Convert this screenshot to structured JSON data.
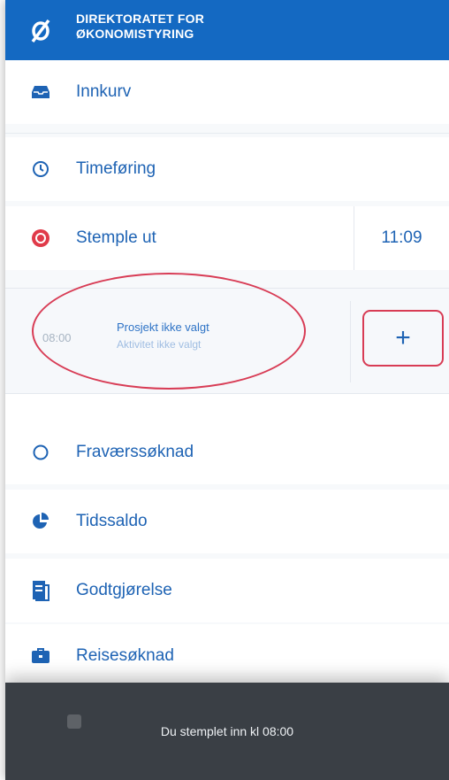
{
  "header": {
    "org_line1": "DIREKTORATET FOR",
    "org_line2": "ØKONOMISTYRING",
    "logo_icon": "slashed-o-logo"
  },
  "menu": {
    "inbox": {
      "label": "Innkurv",
      "icon": "inbox-icon"
    },
    "timeentry": {
      "label": "Timeføring",
      "icon": "clock-icon"
    },
    "stamp": {
      "label": "Stemple ut",
      "time": "11:09",
      "icon": "record-stop-icon"
    },
    "absence": {
      "label": "Fraværssøknad",
      "icon": "circle-outline-icon"
    },
    "balance": {
      "label": "Tidssaldo",
      "icon": "pie-chart-icon"
    },
    "reimbursement": {
      "label": "Godtgjørelse",
      "icon": "receipt-icon"
    },
    "travel": {
      "label": "Reisesøknad",
      "icon": "briefcase-icon"
    }
  },
  "entry": {
    "time": "08:00",
    "project": "Prosjekt ikke valgt",
    "activity": "Aktivitet ikke valgt",
    "add_label": "+"
  },
  "toast": {
    "message": "Du stemplet inn kl 08:00"
  },
  "colors": {
    "brand": "#1469c2",
    "accent_red": "#d83c55",
    "link": "#1e63b4",
    "toast_bg": "#3a3f45"
  }
}
